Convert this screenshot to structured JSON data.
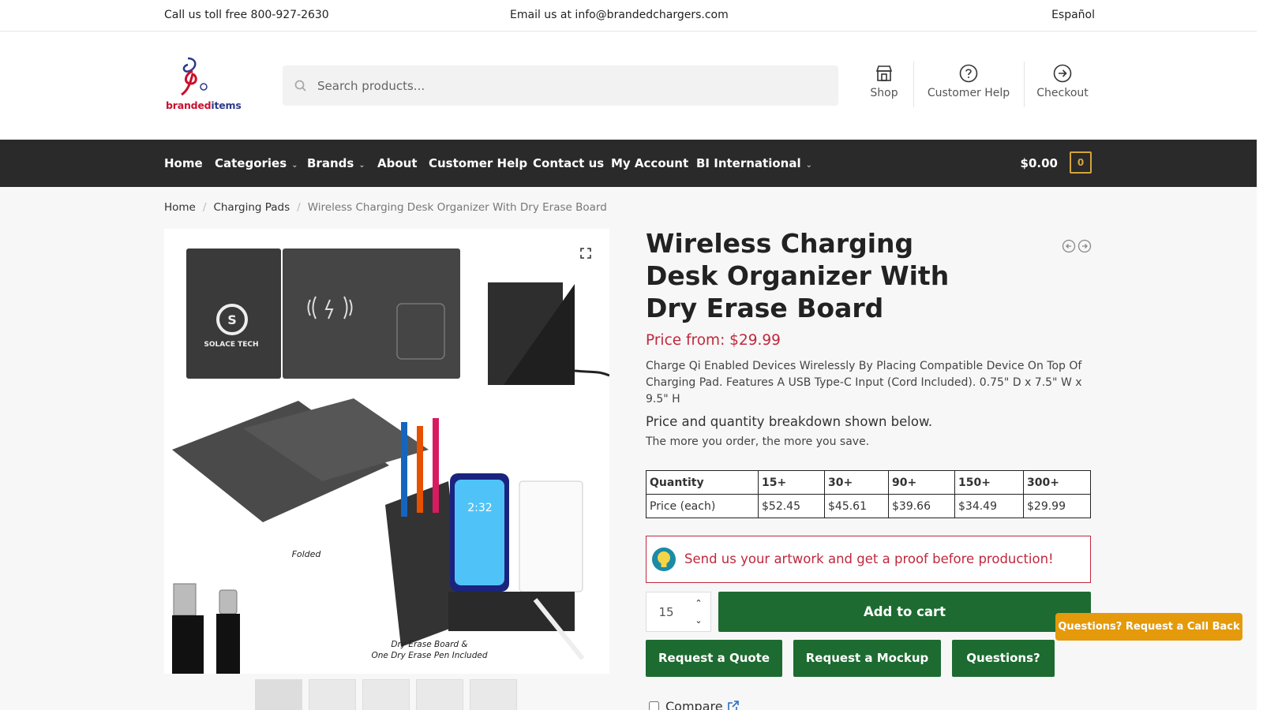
{
  "topbar": {
    "phone": "Call us toll free 800-927-2630",
    "email": "Email us at info@brandedchargers.com",
    "language": "Español"
  },
  "header": {
    "logo_text_red": "branded",
    "logo_text_blue": "items",
    "search_placeholder": "Search products...",
    "shop_label": "Shop",
    "help_label": "Customer Help",
    "checkout_label": "Checkout"
  },
  "nav": {
    "items": [
      "Home",
      "Categories",
      "Brands",
      "About",
      "Customer Help",
      "Contact us",
      "My Account",
      "BI International"
    ],
    "cart_amount": "$0.00",
    "cart_count": "0"
  },
  "breadcrumb": [
    "Home",
    "Charging Pads",
    "Wireless Charging Desk Organizer With Dry Erase Board"
  ],
  "product": {
    "title": "Wireless Charging Desk Organizer With Dry Erase Board",
    "price": "Price from: $29.99",
    "description": "Charge Qi Enabled Devices Wirelessly By Placing Compatible Device On Top Of Charging Pad. Features A USB Type-C Input (Cord Included). 0.75\" D x 7.5\" W x 9.5\" H",
    "breakdown_note": "Price and quantity breakdown shown below.",
    "savings_note": "The more you order, the more you save.",
    "image_captions": {
      "brand": "SOLACE TECH",
      "folded": "Folded",
      "board_line1": "Dry Erase Board &",
      "board_line2": "One Dry Erase Pen Included"
    }
  },
  "price_table": {
    "header": [
      "Quantity",
      "15+",
      "30+",
      "90+",
      "150+",
      "300+"
    ],
    "row": [
      "Price (each)",
      "$52.45",
      "$45.61",
      "$39.66",
      "$34.49",
      "$29.99"
    ]
  },
  "artwork_notice": "Send us your artwork and get a proof before production!",
  "cart": {
    "quantity": "15",
    "add_to_cart": "Add to cart"
  },
  "actions": {
    "quote": "Request a Quote",
    "mockup": "Request a Mockup",
    "questions": "Questions?"
  },
  "compare_label": "Compare",
  "callback_label": "Questions? Request a Call Back",
  "colors": {
    "nav_bg": "#2a2a2a",
    "accent_red": "#c0283d",
    "button_green": "#1d6b30",
    "cart_gold": "#d4a53a",
    "callback_orange": "#e49a0a"
  }
}
